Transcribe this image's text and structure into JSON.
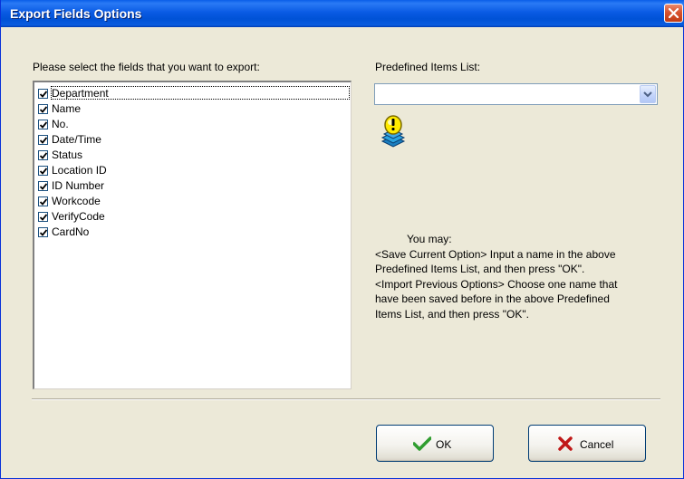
{
  "window": {
    "title": "Export Fields Options",
    "close_icon": "close-icon"
  },
  "fields": {
    "label": "Please select the fields that you want to export:",
    "items": [
      {
        "label": "Department",
        "checked": true
      },
      {
        "label": "Name",
        "checked": true
      },
      {
        "label": "No.",
        "checked": true
      },
      {
        "label": "Date/Time",
        "checked": true
      },
      {
        "label": "Status",
        "checked": true
      },
      {
        "label": "Location ID",
        "checked": true
      },
      {
        "label": "ID Number",
        "checked": true
      },
      {
        "label": "Workcode",
        "checked": true
      },
      {
        "label": "VerifyCode",
        "checked": true
      },
      {
        "label": "CardNo",
        "checked": true
      }
    ]
  },
  "predefined": {
    "label": "Predefined Items List:",
    "value": ""
  },
  "info": {
    "icon": "info-bulb-icon",
    "lines": [
      "You may:",
      "<Save Current Option> Input a name in the above",
      "Predefined Items List, and then press \"OK\".",
      "<Import Previous Options> Choose one name that",
      "have been saved before in the above Predefined",
      "Items List, and then press \"OK\"."
    ]
  },
  "buttons": {
    "ok_label": "OK",
    "cancel_label": "Cancel"
  },
  "colors": {
    "titlebar": "#0a5ee8",
    "dialog_bg": "#ece9d8",
    "ok_check": "#2f9d2f",
    "cancel_x": "#c01818"
  }
}
